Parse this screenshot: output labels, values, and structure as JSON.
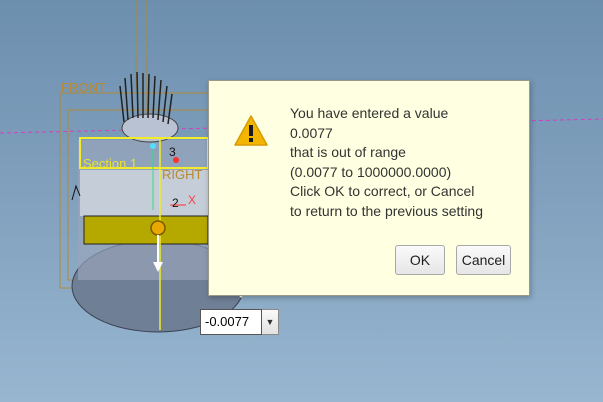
{
  "viewport": {
    "datum_front": "FRONT",
    "datum_right": "RIGHT",
    "section_label": "Section 1",
    "dim_label_3": "3",
    "dim_label_2": "2",
    "axis_x": "X"
  },
  "value_editor": {
    "value": "-0.0077"
  },
  "dialog": {
    "line1": "You have entered a value",
    "line2": "0.0077",
    "line3": "that is out of range",
    "line4": "(0.0077 to 1000000.0000)",
    "line5": "Click OK to correct, or Cancel",
    "line6": "to return to the previous setting",
    "ok_label": "OK",
    "cancel_label": "Cancel",
    "icon": "warning-icon"
  },
  "colors": {
    "dialog_bg": "#ffffe1",
    "warning": "#f0b400",
    "datum": "#b8892f",
    "section": "#e8e233"
  }
}
